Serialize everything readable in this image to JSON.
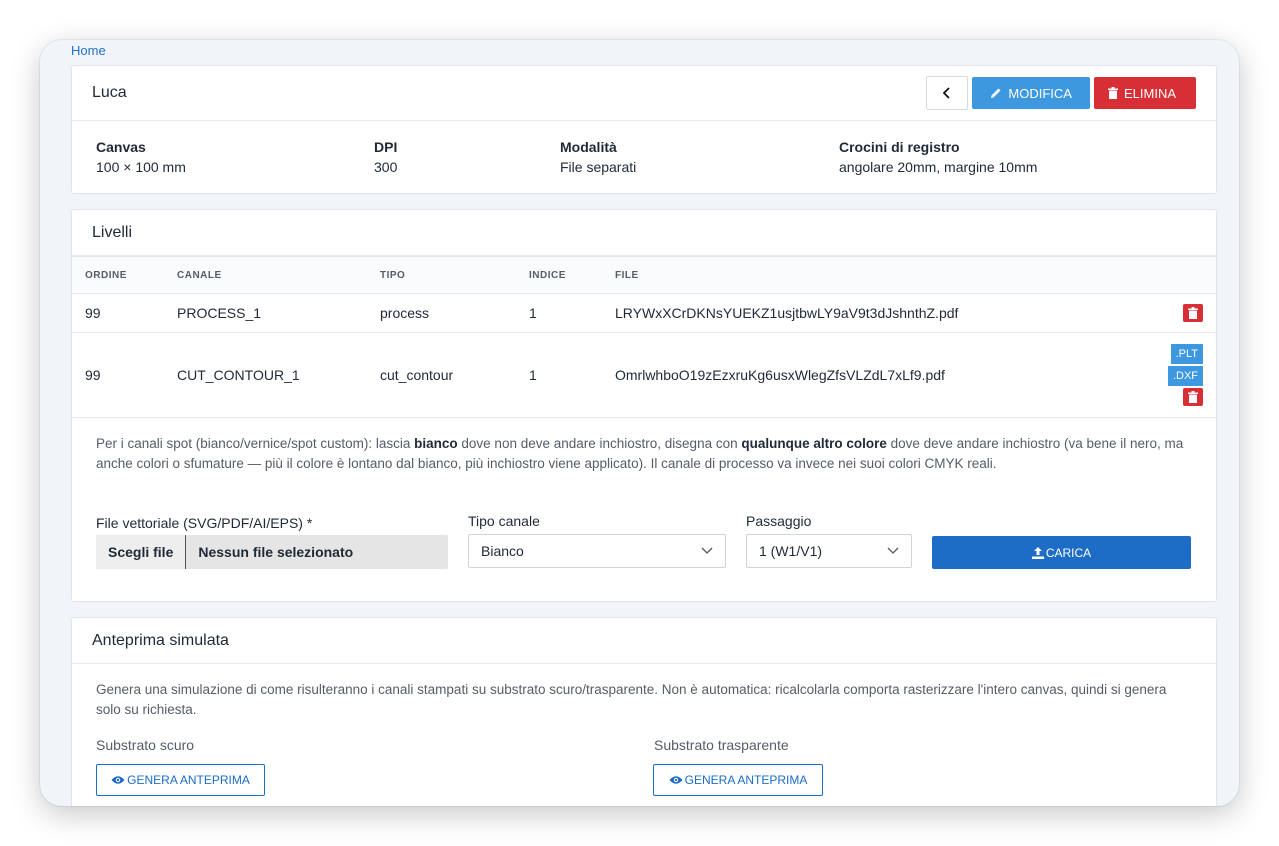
{
  "breadcrumb": {
    "home": "Home"
  },
  "project": {
    "title": "Luca",
    "edit_label": "MODIFICA",
    "delete_label": "ELIMINA",
    "meta": [
      {
        "key": "Canvas",
        "value": "100 × 100 mm"
      },
      {
        "key": "DPI",
        "value": "300"
      },
      {
        "key": "Modalità",
        "value": "File separati"
      },
      {
        "key": "Crocini di registro",
        "value": "angolare 20mm, margine 10mm"
      }
    ]
  },
  "layers": {
    "title": "Livelli",
    "columns": [
      "ORDINE",
      "CANALE",
      "TIPO",
      "INDICE",
      "FILE"
    ],
    "rows": [
      {
        "order": "99",
        "channel": "PROCESS_1",
        "type": "process",
        "index": "1",
        "file": "LRYWxXCrDKNsYUEKZ1usjtbwLY9aV9t3dJshnthZ.pdf"
      },
      {
        "order": "99",
        "channel": "CUT_CONTOUR_1",
        "type": "cut_contour",
        "index": "1",
        "file": "OmrlwhboO19zEzxruKg6usxWlegZfsVLZdL7xLf9.pdf",
        "plt": ".PLT",
        "dxf": ".DXF"
      }
    ],
    "help": {
      "p1": "Per i canali spot (bianco/vernice/spot custom): lascia ",
      "b1": "bianco",
      "p2": " dove non deve andare inchiostro, disegna con ",
      "b2": "qualunque altro colore",
      "p3": " dove deve andare inchiostro (va bene il nero, ma anche colori o sfumature — più il colore è lontano dal bianco, più inchiostro viene applicato). Il canale di processo va invece nei suoi colori CMYK reali."
    },
    "form": {
      "file_label": "File vettoriale (SVG/PDF/AI/EPS) *",
      "file_button": "Scegli file",
      "file_none": "Nessun file selezionato",
      "channel_label": "Tipo canale",
      "channel_value": "Bianco",
      "pass_label": "Passaggio",
      "pass_value": "1 (W1/V1)",
      "upload_label": "CARICA"
    }
  },
  "preview": {
    "title": "Anteprima simulata",
    "description": "Genera una simulazione di come risulteranno i canali stampati su substrato scuro/trasparente. Non è automatica: ricalcolarla comporta rasterizzare l'intero canvas, quindi si genera solo su richiesta.",
    "dark_label": "Substrato scuro",
    "transparent_label": "Substrato trasparente",
    "generate_label": "GENERA ANTEPRIMA"
  },
  "colors": {
    "primary": "#1d6cc6",
    "edit": "#3d98e0",
    "danger": "#d72f35",
    "background": "#f1f4f8"
  }
}
